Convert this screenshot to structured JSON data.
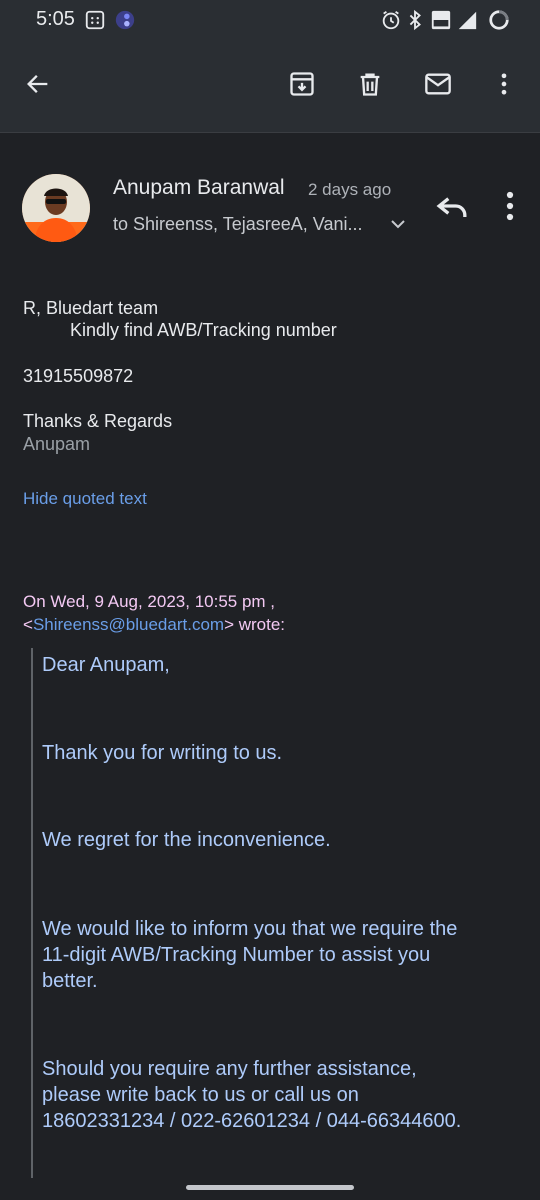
{
  "status": {
    "time": "5:05",
    "icons": [
      "calculator-icon",
      "app-icon",
      "alarm-icon",
      "bluetooth-icon",
      "volte-icon",
      "signal-4g-icon",
      "battery-icon"
    ]
  },
  "toolbar": {
    "back_icon": "back-arrow-icon",
    "actions": [
      "archive-icon",
      "delete-icon",
      "mark-unread-icon",
      "more-icon"
    ]
  },
  "message": {
    "sender": "Anupam Baranwal",
    "time": "2 days ago",
    "recipients": "to Shireenss, TejasreeA, Vani...",
    "body": {
      "greeting": "R, Bluedart team",
      "line1": "Kindly find AWB/Tracking number",
      "tracking": "31915509872",
      "signoff": "Thanks & Regards",
      "signature": "Anupam"
    },
    "hide_quoted": "Hide quoted text"
  },
  "quoted": {
    "header_line1": "On Wed, 9 Aug, 2023, 10:55 pm ,",
    "header_email": "Shireenss@bluedart.com",
    "header_suffix": "> wrote:",
    "header_prefix": "<",
    "greeting": "Dear Anupam,",
    "p1": "Thank you for writing to us.",
    "p2": "We regret for the inconvenience.",
    "p3_l1": "We would like to inform you that we require the",
    "p3_l2": "11-digit AWB/Tracking Number to assist you",
    "p3_l3": "better.",
    "p4_l1": "Should you require any further assistance,",
    "p4_l2": "please write back to us or call us on",
    "p4_l3": "18602331234 / 022-62601234 / 044-66344600."
  },
  "colors": {
    "background": "#1f2125",
    "bar": "#2a2e33",
    "link": "#6a9ee8",
    "quote_text": "#aecbfa",
    "quote_header": "#f3c9f3"
  }
}
